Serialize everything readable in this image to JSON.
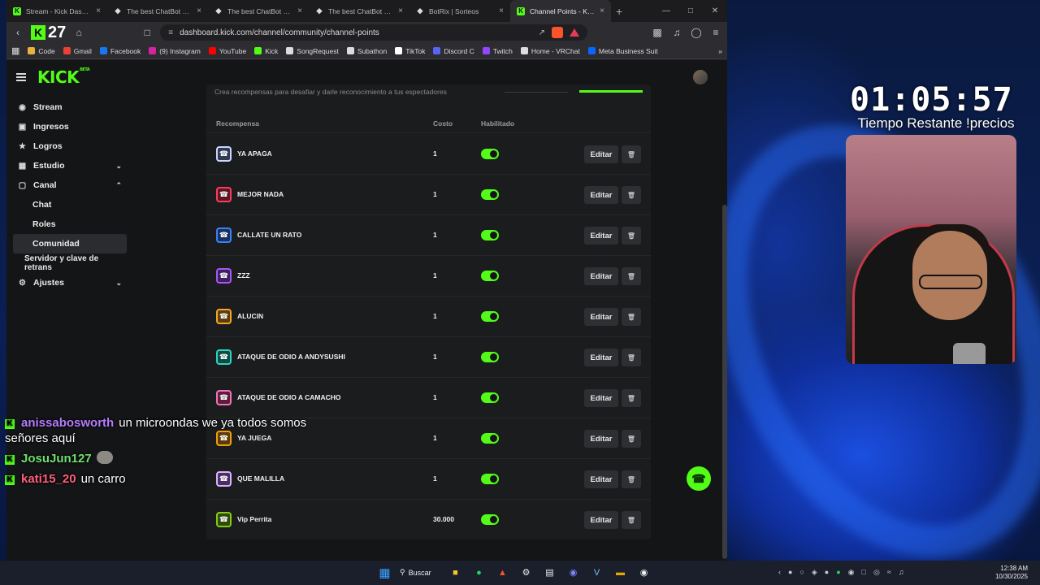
{
  "browser": {
    "tabs": [
      {
        "title": "Stream - Kick Dashbo",
        "icon": "kick-icon",
        "active": false
      },
      {
        "title": "The best ChatBot and",
        "icon": "botrix-icon",
        "active": false
      },
      {
        "title": "The best ChatBot and W",
        "icon": "botrix-icon",
        "active": false
      },
      {
        "title": "The best ChatBot and W",
        "icon": "botrix-icon",
        "active": false
      },
      {
        "title": "BotRix | Sorteos",
        "icon": "botrix-icon",
        "active": false
      },
      {
        "title": "Channel Points - Kick",
        "icon": "kick-icon",
        "active": true
      }
    ],
    "new_tab_label": "+",
    "url": "dashboard.kick.com/channel/community/channel-points",
    "kick_badge_count": "27",
    "bookmarks": [
      {
        "label": "Code",
        "color": "#e8b33a"
      },
      {
        "label": "Gmail",
        "color": "#ea4335"
      },
      {
        "label": "Facebook",
        "color": "#1877f2"
      },
      {
        "label": "(9) Instagram",
        "color": "#d6249f"
      },
      {
        "label": "YouTube",
        "color": "#ff0000"
      },
      {
        "label": "Kick",
        "color": "#53fc18"
      },
      {
        "label": "SongRequest",
        "color": "#dddddd"
      },
      {
        "label": "Subathon",
        "color": "#dddddd"
      },
      {
        "label": "TikTok",
        "color": "#ffffff"
      },
      {
        "label": "Discord C",
        "color": "#5865f2"
      },
      {
        "label": "Twitch",
        "color": "#9146ff"
      },
      {
        "label": "Home - VRChat",
        "color": "#dddddd"
      },
      {
        "label": "Meta Business Suit",
        "color": "#0866ff"
      }
    ]
  },
  "kick": {
    "logo_text": "KICK",
    "logo_beta": "BETA",
    "accent": "#53fc18",
    "sidebar": [
      {
        "label": "Stream",
        "icon": "broadcast-icon",
        "type": "top"
      },
      {
        "label": "Ingresos",
        "icon": "wallet-icon",
        "type": "top"
      },
      {
        "label": "Logros",
        "icon": "trophy-icon",
        "type": "top"
      },
      {
        "label": "Estudio",
        "icon": "studio-icon",
        "type": "top",
        "chevron": "down"
      },
      {
        "label": "Canal",
        "icon": "channel-icon",
        "type": "top",
        "chevron": "up"
      },
      {
        "label": "Chat",
        "type": "sub"
      },
      {
        "label": "Roles",
        "type": "sub"
      },
      {
        "label": "Comunidad",
        "type": "sub",
        "active": true
      },
      {
        "label": "Servidor y clave de retrans",
        "type": "plain"
      },
      {
        "label": "Ajustes",
        "icon": "gear-icon",
        "type": "top",
        "chevron": "down"
      }
    ],
    "panel_description": "Crea recompensas para desafiar y darle reconocimiento a tus espectadores",
    "table_headers": {
      "reward": "Recompensa",
      "cost": "Costo",
      "enabled": "Habilitado"
    },
    "rewards": [
      {
        "name": "YA APAGA",
        "cost": "1",
        "enabled": true,
        "icon_color": "#c9d6ff",
        "icon_bg": "#2f3a55"
      },
      {
        "name": "MEJOR NADA",
        "cost": "1",
        "enabled": true,
        "icon_color": "#ff3b5c",
        "icon_bg": "#5a1622"
      },
      {
        "name": "CALLATE UN RATO",
        "cost": "1",
        "enabled": true,
        "icon_color": "#3b82f6",
        "icon_bg": "#173060"
      },
      {
        "name": "ZZZ",
        "cost": "1",
        "enabled": true,
        "icon_color": "#a855f7",
        "icon_bg": "#3c1f5c"
      },
      {
        "name": "ALUCIN",
        "cost": "1",
        "enabled": true,
        "icon_color": "#f5a623",
        "icon_bg": "#5a3d10"
      },
      {
        "name": "ATAQUE DE ODIO A ANDYSUSHI",
        "cost": "1",
        "enabled": true,
        "icon_color": "#2dd4bf",
        "icon_bg": "#0f4a44"
      },
      {
        "name": "ATAQUE DE ODIO A CAMACHO",
        "cost": "1",
        "enabled": true,
        "icon_color": "#f472b6",
        "icon_bg": "#5a1f3d"
      },
      {
        "name": "YA JUEGA",
        "cost": "1",
        "enabled": true,
        "icon_color": "#f59e0b",
        "icon_bg": "#5a3a08"
      },
      {
        "name": "QUE MALILLA",
        "cost": "1",
        "enabled": true,
        "icon_color": "#d8b4fe",
        "icon_bg": "#4a2f63"
      },
      {
        "name": "Vip Perrita",
        "cost": "30.000",
        "enabled": true,
        "icon_color": "#84cc16",
        "icon_bg": "#2f4a0a"
      }
    ],
    "edit_label": "Editar"
  },
  "overlay": {
    "timer": "01:05:57",
    "timer_label": "Tiempo Restante !precios",
    "chat": [
      {
        "user": "anissabosworth",
        "user_color": "#b57cff",
        "message": "un microondas we ya todos somos señores aquí",
        "emote": false
      },
      {
        "user": "JosuJun127",
        "user_color": "#6ee26e",
        "message": "",
        "emote": true
      },
      {
        "user": "kati15_20",
        "user_color": "#ff5f7e",
        "message": "un carro",
        "emote": false
      }
    ]
  },
  "taskbar": {
    "search_label": "Buscar",
    "clock_time": "12:38 AM",
    "clock_date": "10/30/2025"
  }
}
